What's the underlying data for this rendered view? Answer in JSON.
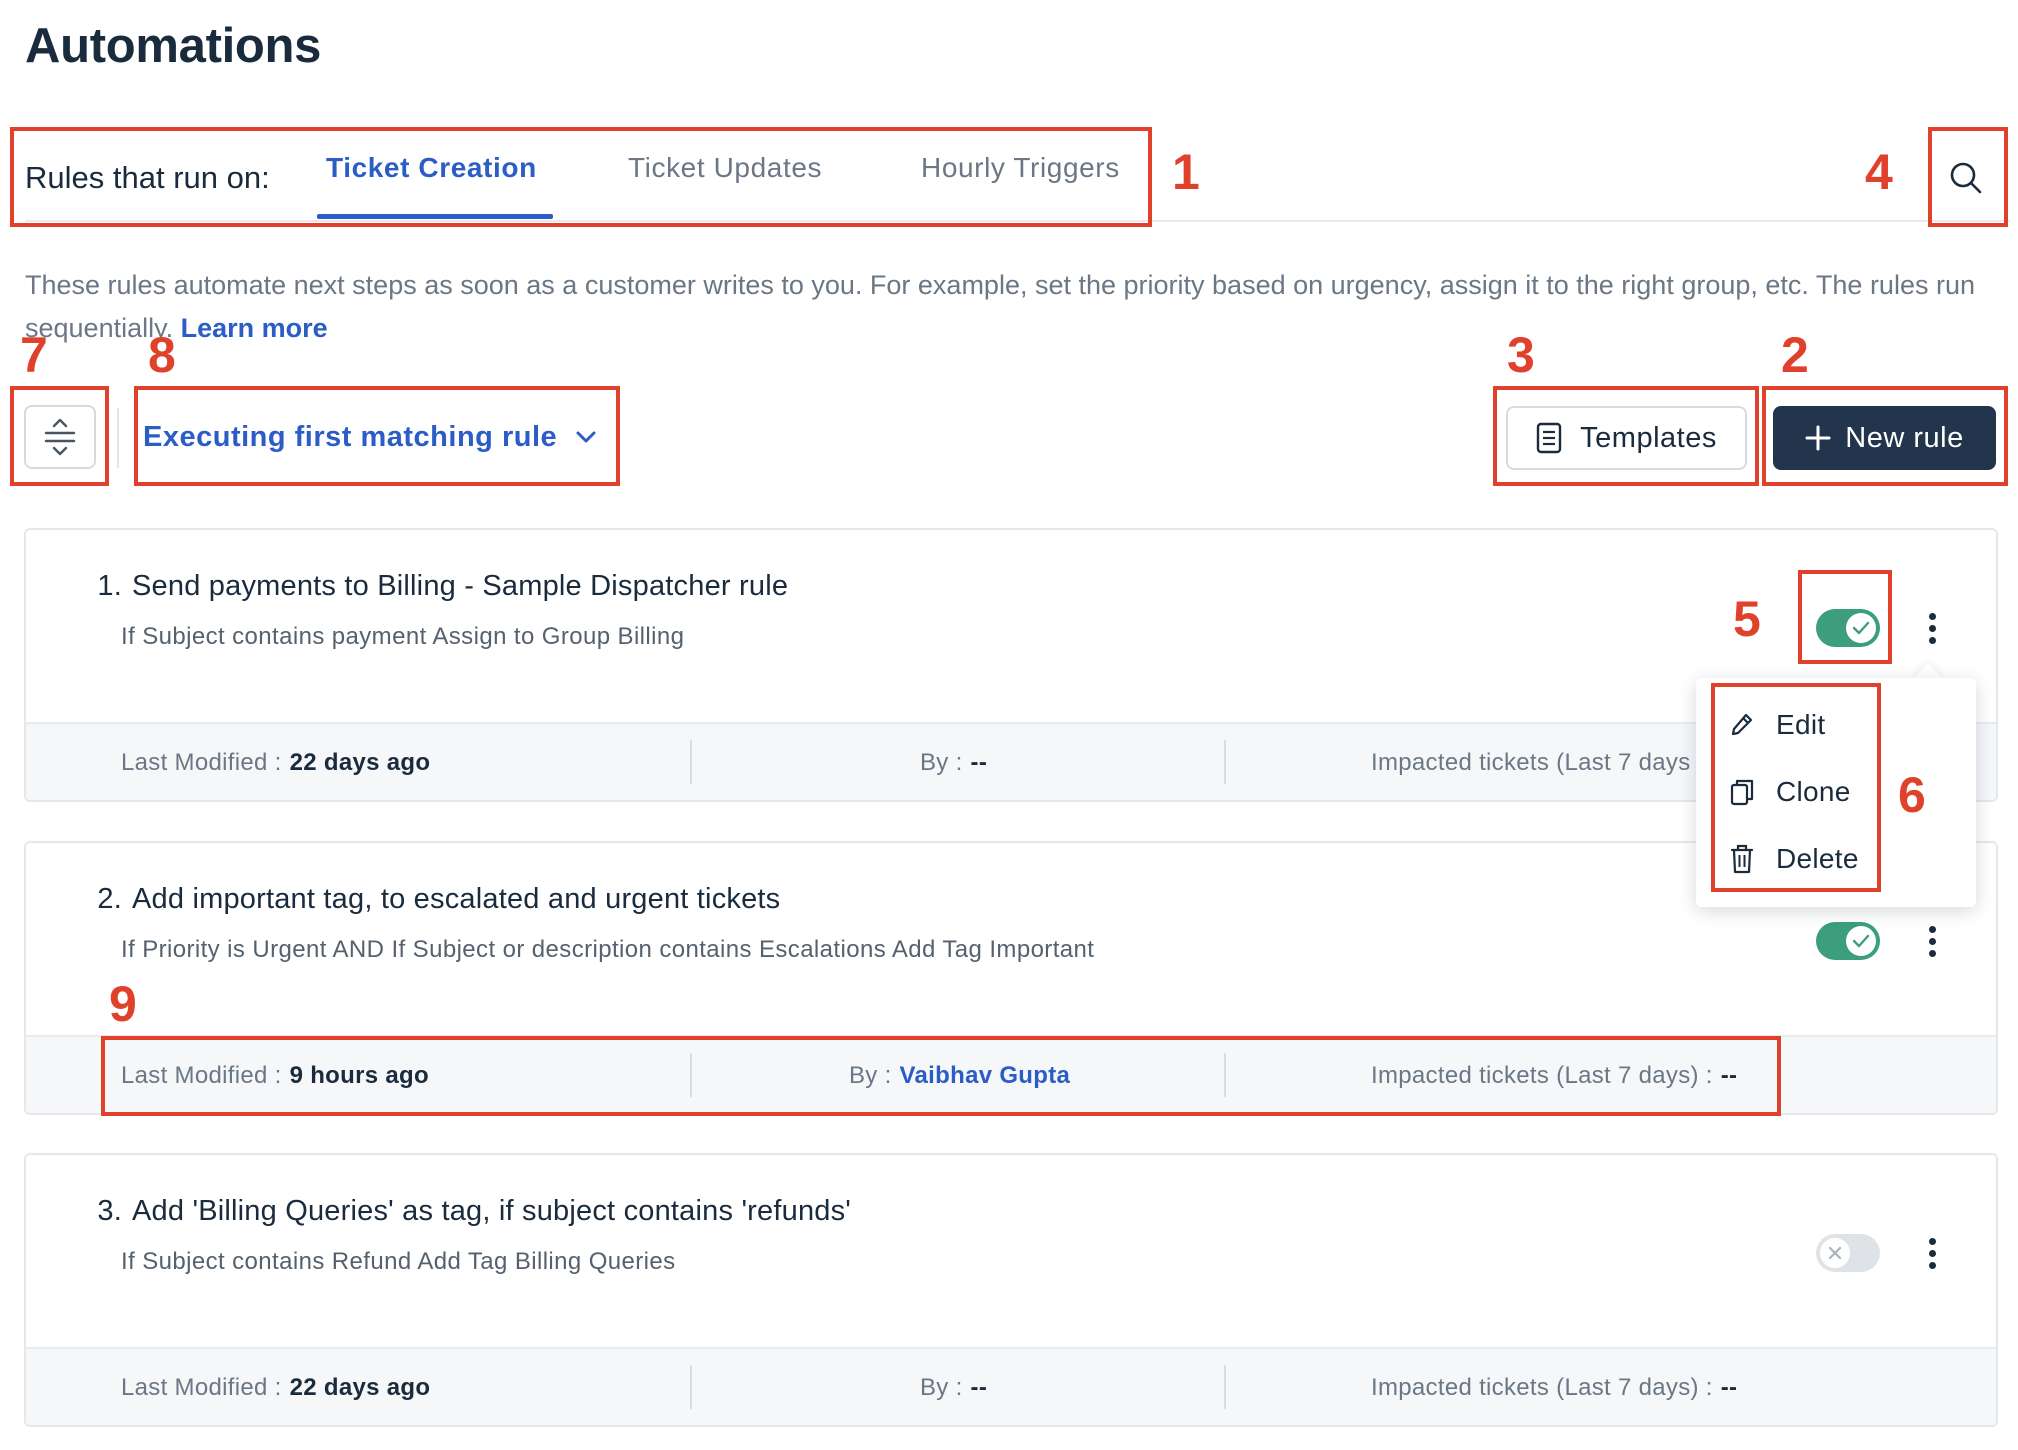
{
  "page": {
    "title": "Automations"
  },
  "tabs": {
    "label": "Rules that run on:",
    "items": [
      {
        "label": "Ticket Creation",
        "active": true
      },
      {
        "label": "Ticket Updates",
        "active": false
      },
      {
        "label": "Hourly Triggers",
        "active": false
      }
    ]
  },
  "search": {
    "icon": "search-icon"
  },
  "description": {
    "text": "These rules automate next steps as soon as a customer writes to you. For example, set the priority based on urgency, assign it to the right group, etc. The rules run sequentially.",
    "link": "Learn more"
  },
  "toolbar": {
    "sort_icon": "sort-icon",
    "execution_mode": "Executing first matching rule",
    "templates_label": "Templates",
    "new_rule_label": "New rule"
  },
  "footer_labels": {
    "last_modified": "Last Modified :",
    "by": "By :",
    "impacted": "Impacted tickets (Last 7 days) :",
    "impacted_truncated": "Impacted tickets (Last 7 days"
  },
  "rules": [
    {
      "number": "1.",
      "title": "Send payments to Billing - Sample Dispatcher rule",
      "condition": "If Subject contains payment Assign to Group Billing",
      "enabled": true,
      "last_modified": "22 days ago",
      "by": "--",
      "impacted": "--"
    },
    {
      "number": "2.",
      "title": "Add important tag, to escalated and urgent tickets",
      "condition": "If Priority is Urgent AND If Subject or description contains Escalations Add Tag Important",
      "enabled": true,
      "last_modified": "9 hours ago",
      "by": "Vaibhav Gupta",
      "impacted": "--"
    },
    {
      "number": "3.",
      "title": "Add 'Billing Queries' as tag, if subject contains 'refunds'",
      "condition": "If Subject contains Refund Add Tag Billing Queries",
      "enabled": false,
      "last_modified": "22 days ago",
      "by": "--",
      "impacted": "--"
    }
  ],
  "menu": {
    "items": [
      {
        "label": "Edit",
        "icon": "pencil-icon"
      },
      {
        "label": "Clone",
        "icon": "copy-icon"
      },
      {
        "label": "Delete",
        "icon": "trash-icon"
      }
    ]
  },
  "annotations": [
    "1",
    "2",
    "3",
    "4",
    "5",
    "6",
    "7",
    "8",
    "9"
  ],
  "colors": {
    "accent": "#2c5cc5",
    "primary_button": "#22354d",
    "toggle_on": "#3c9e7c",
    "toggle_off": "#dfe3e7",
    "annotation": "#e0412b"
  }
}
